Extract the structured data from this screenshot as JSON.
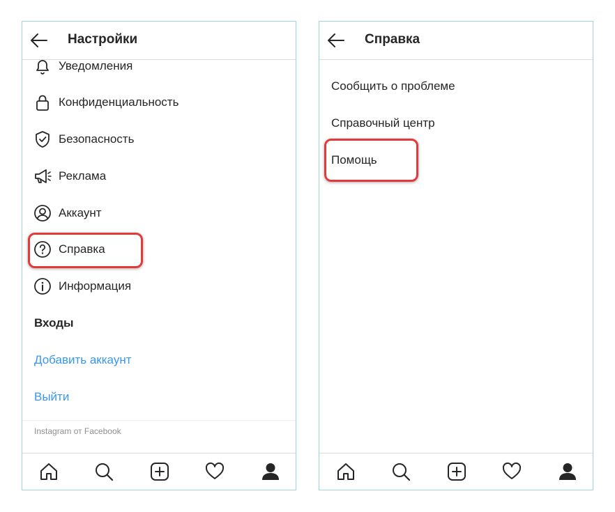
{
  "left_screen": {
    "title": "Настройки",
    "menu_items": [
      {
        "label": "Уведомления",
        "icon": "bell-icon"
      },
      {
        "label": "Конфиденциальность",
        "icon": "lock-icon"
      },
      {
        "label": "Безопасность",
        "icon": "shield-icon"
      },
      {
        "label": "Реклама",
        "icon": "megaphone-icon"
      },
      {
        "label": "Аккаунт",
        "icon": "account-icon"
      },
      {
        "label": "Справка",
        "icon": "help-icon"
      },
      {
        "label": "Информация",
        "icon": "info-icon"
      }
    ],
    "logins_section": "Входы",
    "add_account": "Добавить аккаунт",
    "logout": "Выйти",
    "footer": "Instagram от Facebook"
  },
  "right_screen": {
    "title": "Справка",
    "items": [
      "Сообщить  о проблеме",
      "Справочный центр",
      "Помощь"
    ]
  },
  "bottom_nav": [
    "home-icon",
    "search-icon",
    "new-post-icon",
    "activity-heart-icon",
    "profile-icon"
  ],
  "colors": {
    "link": "#3897f0",
    "highlight": "#e23a3a",
    "frame": "#9fd3df",
    "text": "#262626"
  }
}
